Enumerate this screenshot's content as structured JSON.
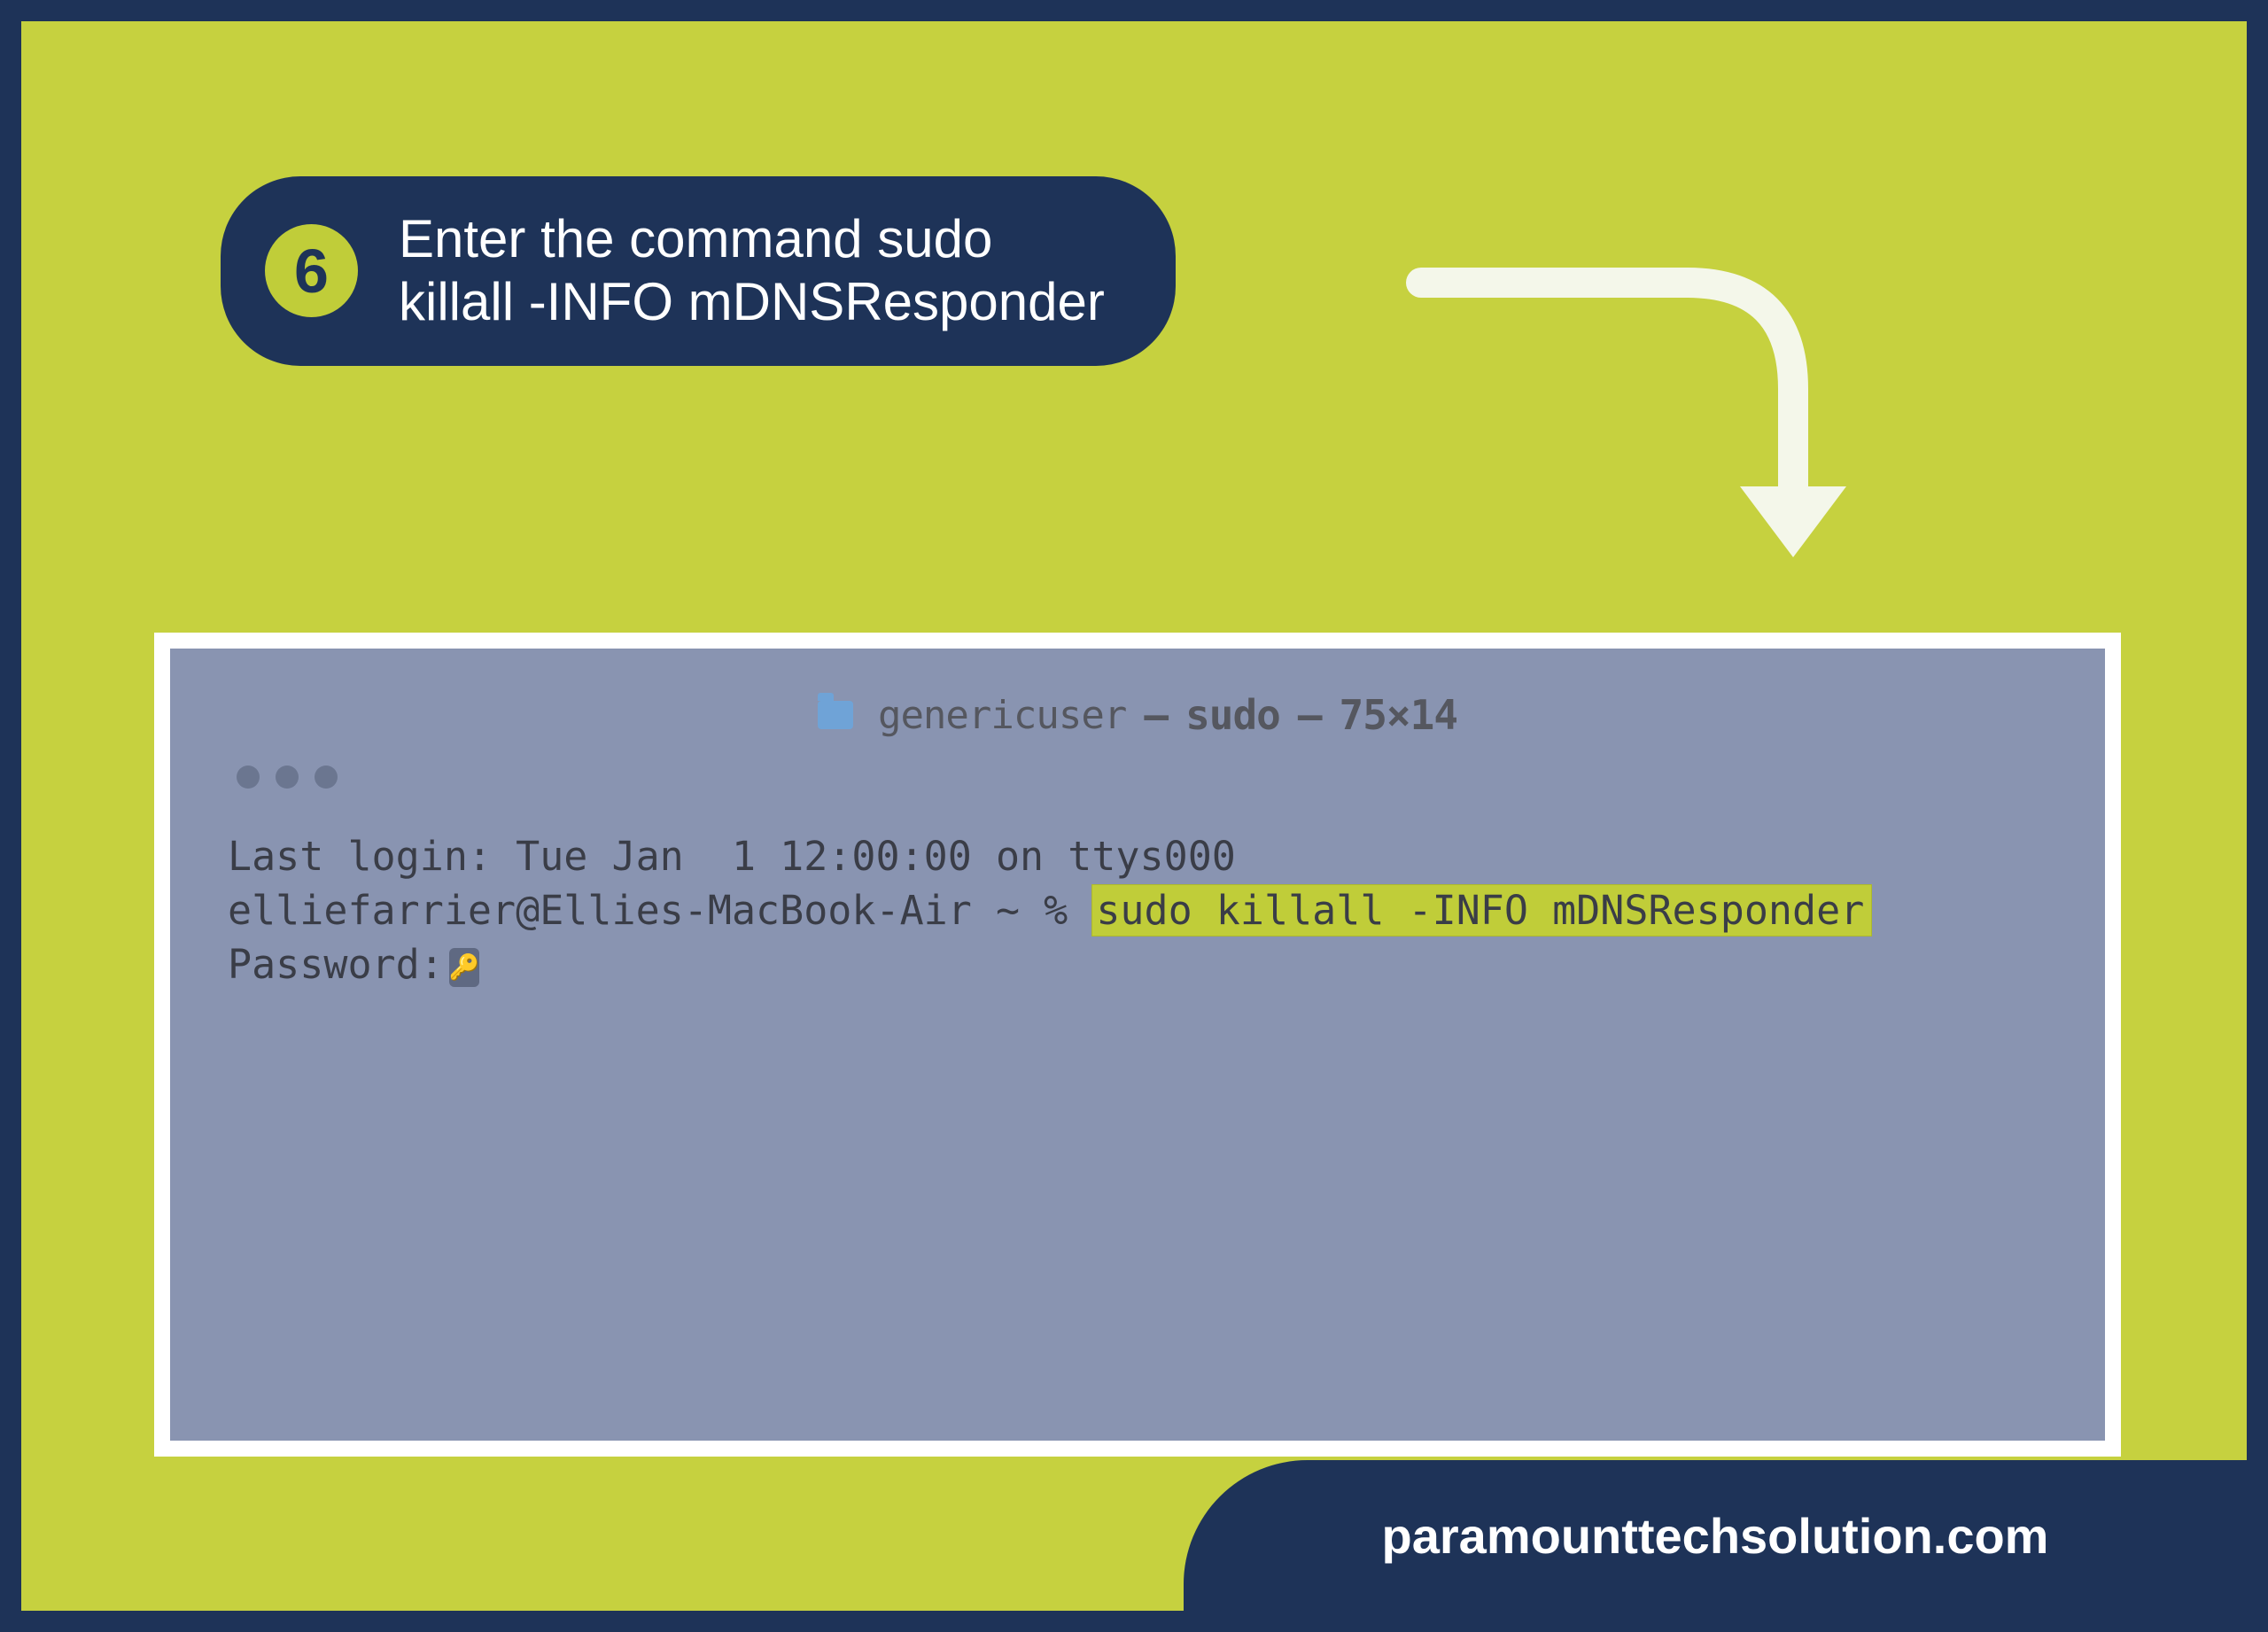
{
  "step": {
    "number": "6",
    "line1": "Enter the command sudo",
    "line2": "killall -INFO mDNSResponder"
  },
  "terminal": {
    "title_user": "genericuser",
    "title_process": "sudo",
    "title_size": "75×14",
    "last_login": "Last login: Tue Jan  1 12:00:00 on ttys000",
    "prompt": "elliefarrier@Ellies-MacBook-Air ~ % ",
    "command": "sudo killall -INFO mDNSResponder",
    "password_label": "Password:"
  },
  "footer": {
    "brand": "paramounttechsolution.com"
  }
}
